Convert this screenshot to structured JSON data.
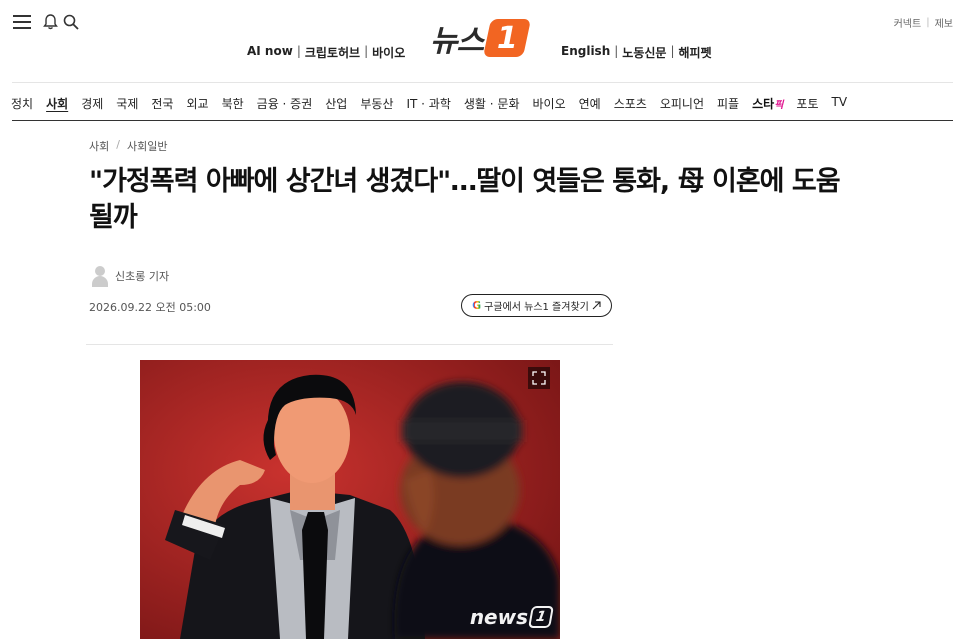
{
  "header": {
    "top_links": [
      "커넥트",
      "제보"
    ],
    "sub_nav_left": [
      "AI now",
      "크립토허브",
      "바이오"
    ],
    "sub_nav_right": [
      "English",
      "노동신문",
      "해피펫"
    ],
    "logo_text": "뉴스",
    "logo_badge": "1"
  },
  "nav": {
    "categories": [
      "정치",
      "사회",
      "경제",
      "국제",
      "전국",
      "외교",
      "북한",
      "금융 · 증권",
      "산업",
      "부동산",
      "IT · 과학",
      "생활 · 문화",
      "바이오",
      "연예",
      "스포츠",
      "오피니언",
      "피플"
    ],
    "star_main": "스타",
    "star_suffix": "픽",
    "tail": [
      "포토",
      "TV"
    ]
  },
  "article": {
    "breadcrumb": [
      "사회",
      "사회일반"
    ],
    "title": "\"가정폭력 아빠에 상간녀 생겼다\"…딸이 엿들은 통화, 母 이혼에 도움 될까",
    "author": "신초롱 기자",
    "date": "2026.09.22 오전 05:00",
    "google_button": "구글에서 뉴스1 즐겨찾기",
    "google_letter": "G",
    "watermark_text": "news",
    "watermark_badge": "1"
  },
  "colors": {
    "brand": "#f26522",
    "star_accent": "#e0118e",
    "photo_bg": "#9c2121"
  }
}
